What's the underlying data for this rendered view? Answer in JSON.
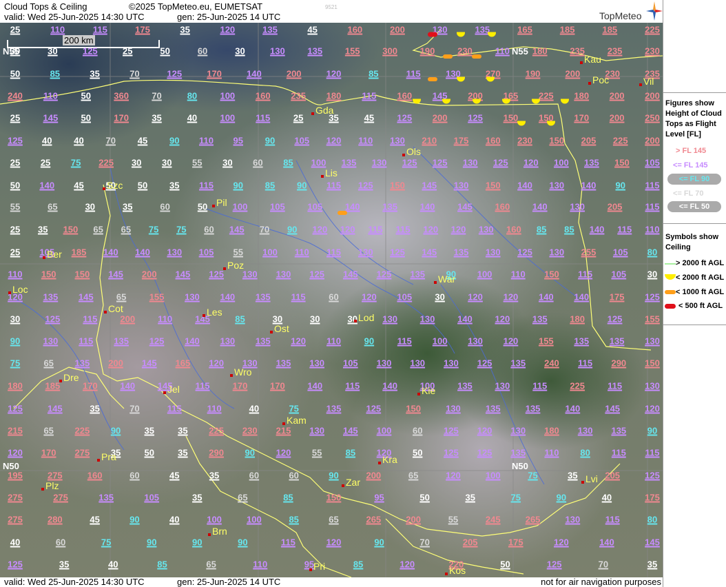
{
  "header": {
    "title": "Cloud Tops & Ceiling",
    "copyright": "©2025 TopMeteo.eu, EUMETSAT",
    "valid": "valid:  Wed  25-Jun-2025  14:30 UTC",
    "gen": "gen: 25-Jun-2025 14 UTC",
    "code": "9521",
    "logo": "TopMeteo"
  },
  "scale": {
    "label": "200 km"
  },
  "footer": {
    "valid": "valid:  Wed  25-Jun-2025  14:30 UTC",
    "gen": "gen: 25-Jun-2025 14 UTC",
    "disclaimer": "not for air navigation purposes"
  },
  "legend": {
    "figures_title": "Figures show Height of Cloud Tops as Flight Level [FL]",
    "figures_lines": [
      "Figures show",
      "Height of Cloud",
      "Tops as Flight",
      "Level  [FL]"
    ],
    "items": [
      "> FL 145",
      "<= FL 145",
      "<= FL 90",
      "<= FL 70",
      "<= FL 50"
    ],
    "item_colors": [
      "#f08890",
      "#c78cff",
      "#66e6ee",
      "#d8d8d8",
      "#ffffff"
    ],
    "symbols_lines": [
      "Symbols show",
      "Ceiling"
    ],
    "symbols": [
      "> 2000 ft AGL",
      "< 2000 ft AGL",
      "< 1000 ft AGL",
      "< 500 ft AGL"
    ],
    "symbol_colors": [
      "#a8f0a0",
      "#ffee00",
      "#ff9f1a",
      "#e0101a"
    ]
  },
  "lat_labels": [
    "N55",
    "N55",
    "N50",
    "N50"
  ],
  "cities": [
    "Gda",
    "Kau",
    "Poc",
    "Vil",
    "Ols",
    "Szc",
    "Lis",
    "Pil",
    "Ber",
    "Poz",
    "War",
    "Loc",
    "Cot",
    "Les",
    "Ost",
    "Lod",
    "Dre",
    "Wro",
    "Jel",
    "Kie",
    "Kam",
    "Pra",
    "Kra",
    "Plz",
    "Zar",
    "Lvi",
    "Brn",
    "Pri",
    "Kos"
  ],
  "cloud_tops": [
    [
      25,
      110,
      115,
      175,
      35,
      120,
      135,
      45,
      160,
      200,
      130,
      135,
      165,
      185,
      185,
      225
    ],
    [
      30,
      30,
      125,
      25,
      50,
      60,
      30,
      130,
      135,
      155,
      300,
      190,
      230,
      110,
      180,
      235,
      235,
      230
    ],
    [
      50,
      85,
      35,
      70,
      125,
      170,
      140,
      200,
      120,
      85,
      115,
      130,
      270,
      190,
      200,
      230,
      235
    ],
    [
      240,
      110,
      50,
      360,
      70,
      80,
      100,
      160,
      235,
      180,
      115,
      160,
      145,
      200,
      165,
      225,
      180,
      200,
      200
    ],
    [
      25,
      145,
      50,
      170,
      35,
      40,
      100,
      115,
      25,
      35,
      45,
      125,
      200,
      125,
      150,
      150,
      170,
      200,
      250
    ],
    [
      125,
      40,
      40,
      70,
      45,
      90,
      110,
      95,
      90,
      105,
      120,
      110,
      130,
      210,
      175,
      160,
      230,
      150,
      205,
      225,
      200
    ],
    [
      25,
      25,
      75,
      225,
      30,
      30,
      55,
      30,
      60,
      85,
      100,
      135,
      130,
      125,
      125,
      130,
      125,
      120,
      100,
      135,
      150,
      105
    ],
    [
      50,
      140,
      45,
      50,
      50,
      35,
      115,
      90,
      85,
      90,
      115,
      125,
      150,
      145,
      130,
      150,
      140,
      130,
      140,
      90,
      115
    ],
    [
      55,
      65,
      30,
      35,
      60,
      50,
      100,
      105,
      105,
      140,
      135,
      140,
      145,
      160,
      140,
      130,
      205,
      115
    ],
    [
      25,
      35,
      150,
      65,
      65,
      75,
      75,
      60,
      145,
      70,
      90,
      120,
      120,
      115,
      115,
      120,
      120,
      130,
      160,
      85,
      85,
      140,
      115,
      110
    ],
    [
      25,
      105,
      185,
      140,
      140,
      130,
      105,
      55,
      100,
      110,
      115,
      130,
      125,
      145,
      135,
      130,
      125,
      130,
      255,
      105,
      80
    ],
    [
      110,
      150,
      150,
      145,
      200,
      145,
      125,
      130,
      130,
      125,
      145,
      125,
      135,
      90,
      100,
      110,
      150,
      115,
      105,
      30
    ],
    [
      120,
      135,
      145,
      65,
      155,
      130,
      140,
      135,
      115,
      60,
      120,
      105,
      30,
      120,
      120,
      140,
      140,
      175,
      125
    ],
    [
      30,
      125,
      115,
      200,
      110,
      145,
      85,
      30,
      30,
      30,
      130,
      130,
      140,
      120,
      135,
      180,
      125,
      155
    ],
    [
      90,
      130,
      115,
      135,
      125,
      140,
      130,
      135,
      120,
      110,
      90,
      115,
      100,
      130,
      120,
      155,
      135,
      135,
      130
    ],
    [
      75,
      65,
      135,
      200,
      145,
      165,
      120,
      130,
      135,
      130,
      105,
      130,
      130,
      130,
      125,
      135,
      240,
      115,
      290,
      150
    ],
    [
      180,
      185,
      170,
      140,
      145,
      115,
      170,
      170,
      140,
      115,
      140,
      100,
      135,
      130,
      115,
      225,
      115,
      130
    ],
    [
      125,
      145,
      35,
      70,
      115,
      110,
      40,
      75,
      135,
      125,
      150,
      130,
      135,
      135,
      140,
      145,
      120
    ],
    [
      215,
      65,
      225,
      90,
      35,
      35,
      225,
      230,
      215,
      130,
      145,
      100,
      60,
      125,
      120,
      130,
      180,
      130,
      135,
      90
    ],
    [
      120,
      170,
      275,
      35,
      50,
      35,
      290,
      90,
      120,
      55,
      85,
      120,
      50,
      125,
      125,
      135,
      110,
      80,
      115,
      115
    ],
    [
      195,
      275,
      160,
      60,
      45,
      35,
      60,
      60,
      90,
      200,
      65,
      120,
      100,
      75,
      35,
      205,
      125
    ],
    [
      275,
      275,
      135,
      105,
      35,
      65,
      85,
      150,
      95,
      50,
      35,
      75,
      90,
      40,
      175
    ],
    [
      275,
      280,
      45,
      90,
      40,
      100,
      100,
      85,
      65,
      265,
      200,
      55,
      245,
      265,
      130,
      115,
      80
    ],
    [
      40,
      60,
      75,
      90,
      90,
      90,
      115,
      120,
      90,
      70,
      205,
      175,
      120,
      140,
      145
    ],
    [
      125,
      35,
      40,
      85,
      65,
      110,
      95,
      85,
      120,
      220,
      50,
      125,
      70,
      35
    ]
  ]
}
